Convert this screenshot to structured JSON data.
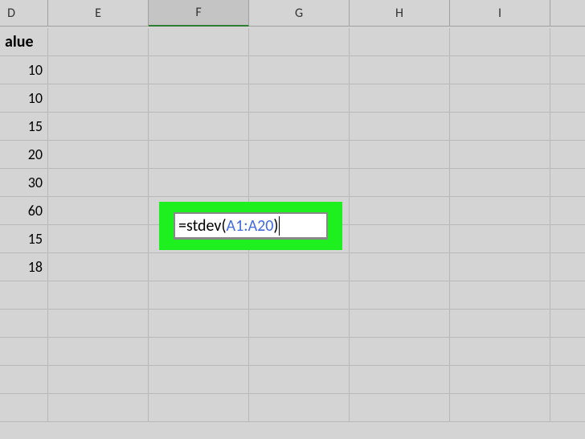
{
  "columns": [
    "D",
    "E",
    "F",
    "G",
    "H",
    "I"
  ],
  "selected_column": "F",
  "header_row": {
    "label": "alue"
  },
  "data_column": {
    "values": [
      "10",
      "10",
      "15",
      "20",
      "30",
      "60",
      "15",
      "18"
    ]
  },
  "formula": {
    "prefix": "=",
    "function": "stdev",
    "open_paren": "(",
    "reference": "A1:A20",
    "close_paren": ")"
  }
}
